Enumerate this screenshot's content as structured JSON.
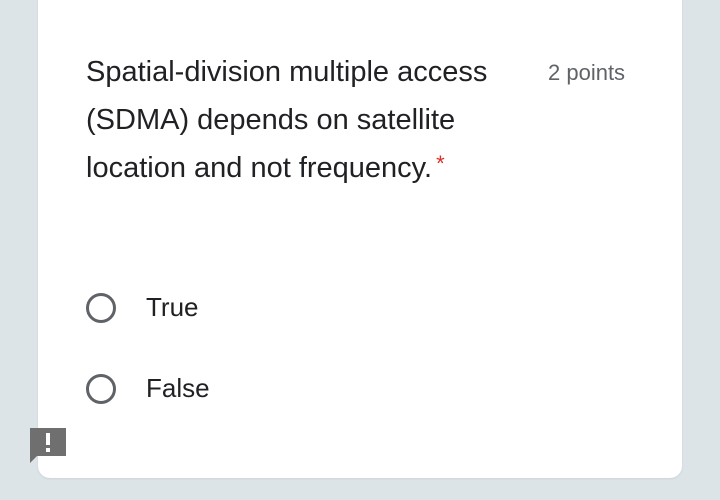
{
  "question": {
    "title": "Spatial-division multiple access (SDMA) depends on satellite location and not frequency.",
    "required_marker": "*",
    "points": "2 points"
  },
  "options": [
    {
      "label": "True"
    },
    {
      "label": "False"
    }
  ],
  "colors": {
    "background": "#dde4e8",
    "card": "#ffffff",
    "required": "#d93025",
    "radio_border": "#5f6368",
    "feedback_button": "#6f6f6f"
  },
  "icons": {
    "feedback": "report-problem-icon"
  }
}
